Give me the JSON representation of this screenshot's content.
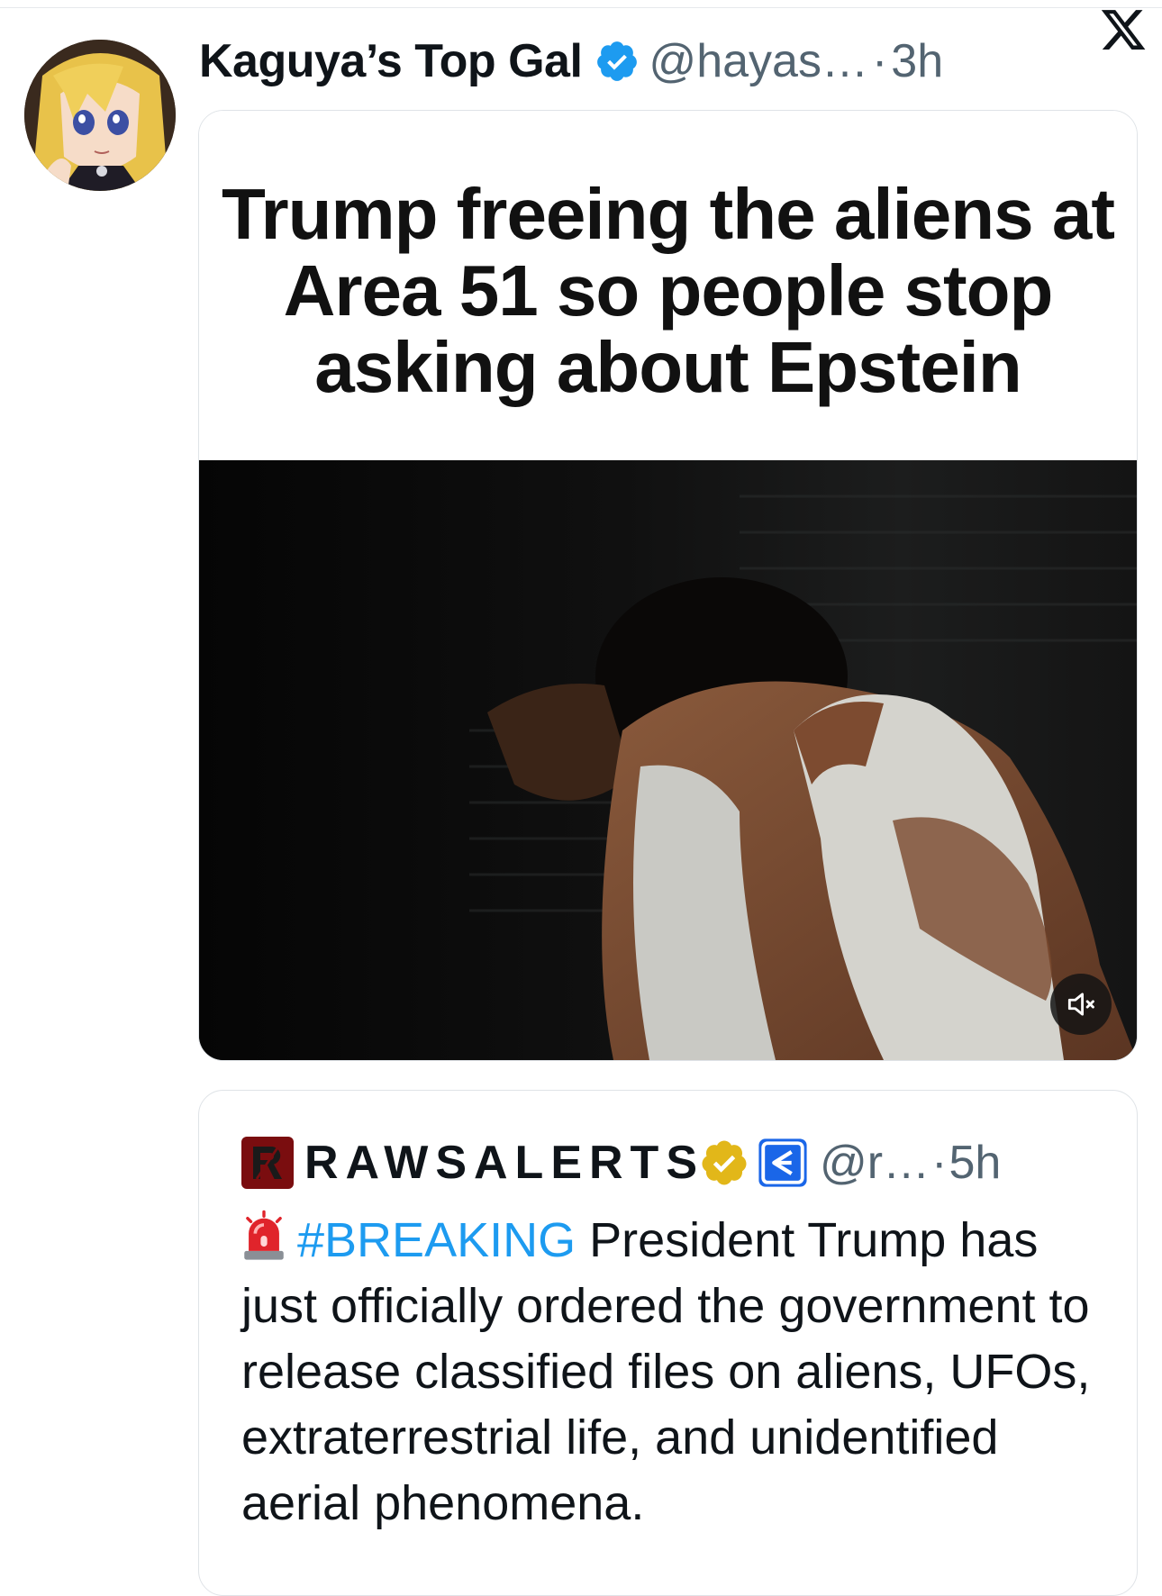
{
  "author": {
    "display_name": "Kaguya’s Top Gal",
    "handle": "@hayas…",
    "separator": "·",
    "time": "3h",
    "verified_color": "#1d9bf0"
  },
  "platform_icon": "x-logo-icon",
  "media": {
    "caption": "Trump freeing the aliens at Area 51 so people stop asking about Epstein",
    "mute_icon": "speaker-muted-icon"
  },
  "quoted_tweet": {
    "display_name": "RAWSALERTS",
    "handle": "@r…",
    "separator": "·",
    "time": "5h",
    "badge_color": "#e2b719",
    "affiliate_color": "#1a66e8",
    "emoji": "rotating-light-icon",
    "hashtag": "#BREAKING",
    "text": " President Trump has just officially ordered the government to release classified files on aliens, UFOs, extraterrestrial life, and unidentified aerial phenomena."
  },
  "colors": {
    "link": "#1d9bf0",
    "secondary_text": "#536471",
    "border": "#dfe3e7"
  }
}
